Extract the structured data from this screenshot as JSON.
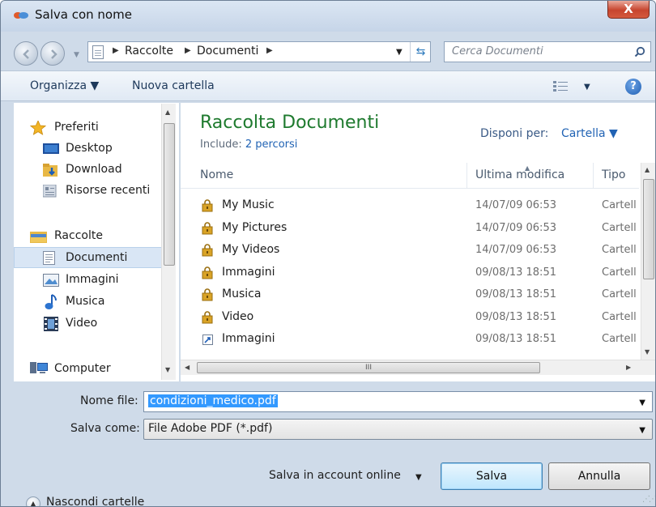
{
  "window": {
    "title": "Salva con nome",
    "close_glyph": "X"
  },
  "navigation": {
    "breadcrumbs": [
      "Raccolte",
      "Documenti"
    ],
    "search_placeholder": "Cerca Documenti"
  },
  "toolbar": {
    "organize": "Organizza ▼",
    "new_folder": "Nuova cartella",
    "help": "?"
  },
  "sidebar": {
    "favorites": {
      "label": "Preferiti",
      "items": [
        "Desktop",
        "Download",
        "Risorse recenti"
      ]
    },
    "libraries": {
      "label": "Raccolte",
      "items": [
        "Documenti",
        "Immagini",
        "Musica",
        "Video"
      ],
      "selected": "Documenti"
    },
    "computer": {
      "label": "Computer"
    }
  },
  "library": {
    "title": "Raccolta Documenti",
    "include_label": "Include:",
    "include_link": "2 percorsi",
    "arrange_label": "Disponi per:",
    "arrange_value": "Cartella ▼"
  },
  "file_list": {
    "columns": {
      "name": "Nome",
      "modified": "Ultima modifica",
      "type": "Tipo"
    },
    "rows": [
      {
        "name": "My Music",
        "date": "14/07/09 06:53",
        "type": "Cartell",
        "icon": "locked-folder-icon"
      },
      {
        "name": "My Pictures",
        "date": "14/07/09 06:53",
        "type": "Cartell",
        "icon": "locked-folder-icon"
      },
      {
        "name": "My Videos",
        "date": "14/07/09 06:53",
        "type": "Cartell",
        "icon": "locked-folder-icon"
      },
      {
        "name": "Immagini",
        "date": "09/08/13 18:51",
        "type": "Cartell",
        "icon": "locked-folder-icon"
      },
      {
        "name": "Musica",
        "date": "09/08/13 18:51",
        "type": "Cartell",
        "icon": "locked-folder-icon"
      },
      {
        "name": "Video",
        "date": "09/08/13 18:51",
        "type": "Cartell",
        "icon": "locked-folder-icon"
      },
      {
        "name": "Immagini",
        "date": "09/08/13 18:51",
        "type": "Cartell",
        "icon": "shortcut-icon"
      }
    ],
    "hscroll_grip": "III"
  },
  "form": {
    "filename_label": "Nome file:",
    "filename_value": "condizioni_medico.pdf",
    "type_label": "Salva come:",
    "type_value": "File Adobe PDF (*.pdf)",
    "hide_folders": "Nascondi cartelle",
    "online": "Salva in account online",
    "save": "Salva",
    "cancel": "Annulla"
  },
  "colors": {
    "accent_green": "#1e7a2e",
    "link_blue": "#2163b4",
    "frame": "#cfdbe9",
    "close_red": "#c7452e"
  }
}
